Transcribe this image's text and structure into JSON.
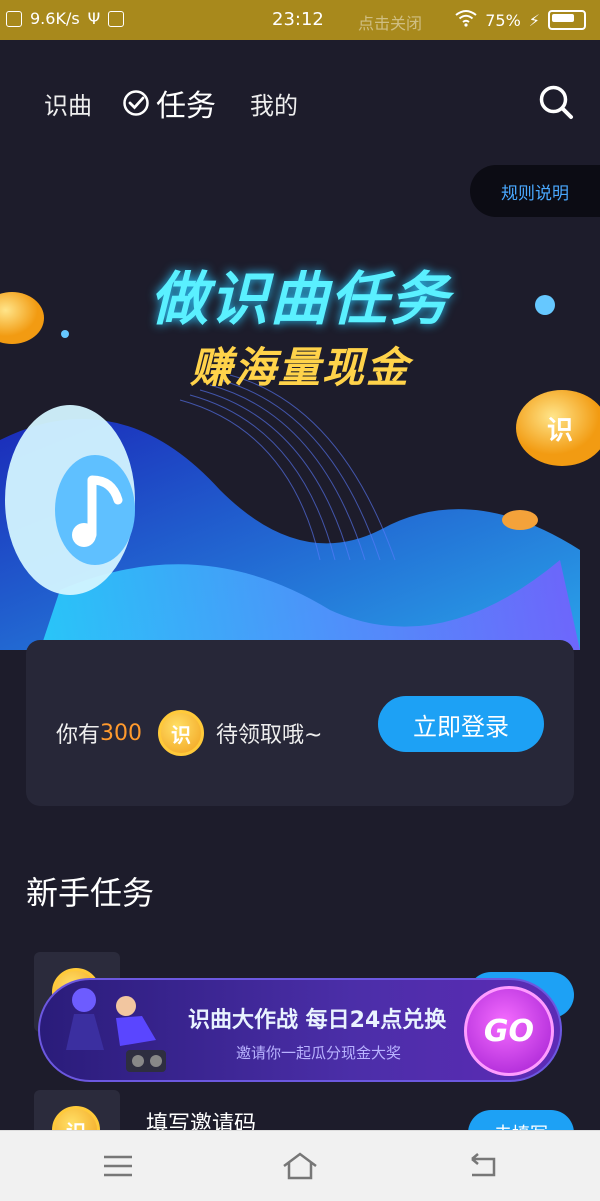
{
  "status_bar": {
    "speed": "9.6K/s",
    "time": "23:12",
    "hint": "点击关闭",
    "battery": "75%"
  },
  "nav": {
    "tabs": [
      "识曲",
      "任务",
      "我的"
    ],
    "active_tab": "任务"
  },
  "rules_button": "规则说明",
  "hero": {
    "title": "做识曲任务",
    "subtitle": "赚海量现金"
  },
  "reward_card": {
    "prefix": "你有",
    "amount": "300",
    "coin_symbol": "识",
    "suffix": "待领取哦~",
    "login_button": "立即登录"
  },
  "section": {
    "title": "新手任务"
  },
  "tasks": [
    {
      "label": "填写邀请码",
      "button": "去填写",
      "coin_symbol": "识"
    }
  ],
  "banner": {
    "title": "识曲大作战 每日24点兑换",
    "subtitle": "邀请你一起瓜分现金大奖",
    "go_button": "GO"
  },
  "colors": {
    "background": "#1d1c2b",
    "accent_blue": "#1da1f5",
    "coin_gold": "#ffca3a",
    "amount_orange": "#ff9a2d"
  }
}
